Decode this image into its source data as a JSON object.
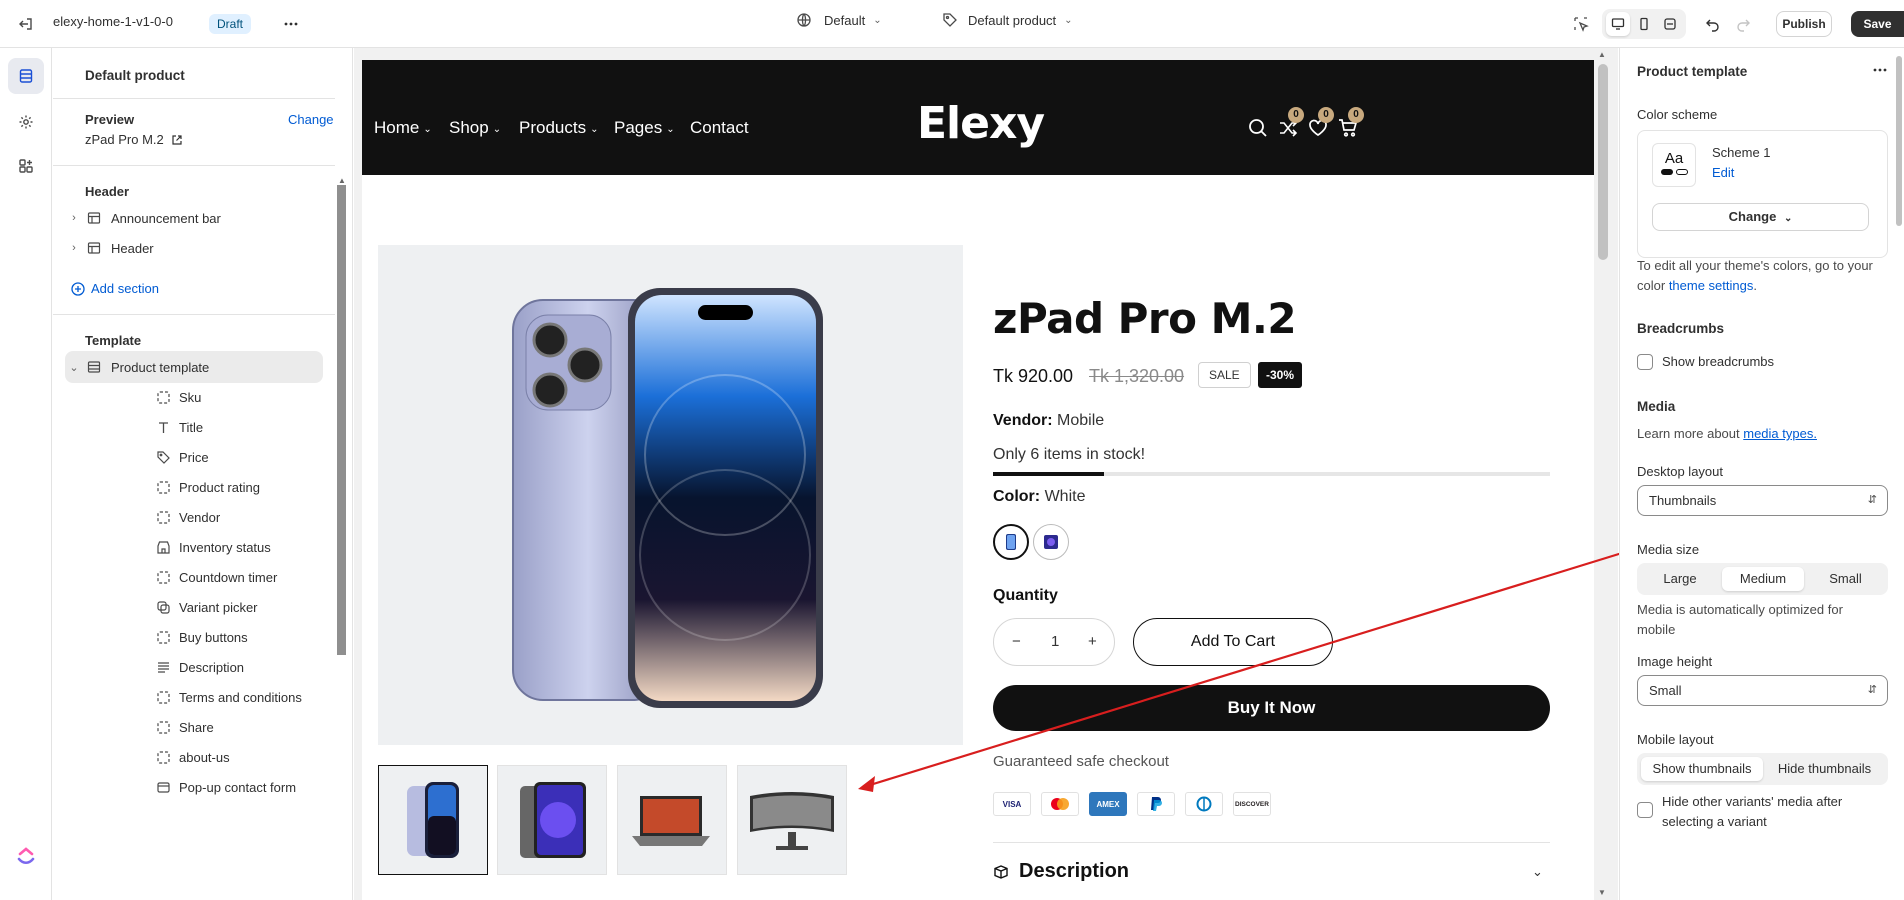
{
  "topbar": {
    "theme_name": "elexy-home-1-v1-0-0",
    "status_badge": "Draft",
    "context_select": "Default",
    "template_select": "Default product",
    "publish_label": "Publish",
    "save_label": "Save"
  },
  "sidebar": {
    "title": "Default product",
    "preview_label": "Preview",
    "preview_change": "Change",
    "preview_value": "zPad Pro M.2",
    "header_group": "Header",
    "header_items": [
      {
        "label": "Announcement bar"
      },
      {
        "label": "Header"
      }
    ],
    "add_section": "Add section",
    "template_group": "Template",
    "template_section": "Product template",
    "blocks": [
      {
        "label": "Sku",
        "icon": "dashed-square-icon"
      },
      {
        "label": "Title",
        "icon": "text-icon"
      },
      {
        "label": "Price",
        "icon": "price-tag-icon"
      },
      {
        "label": "Product rating",
        "icon": "dashed-square-icon"
      },
      {
        "label": "Vendor",
        "icon": "dashed-square-icon"
      },
      {
        "label": "Inventory status",
        "icon": "store-icon"
      },
      {
        "label": "Countdown timer",
        "icon": "dashed-square-icon"
      },
      {
        "label": "Variant picker",
        "icon": "variant-icon"
      },
      {
        "label": "Buy buttons",
        "icon": "dashed-square-icon"
      },
      {
        "label": "Description",
        "icon": "paragraph-icon"
      },
      {
        "label": "Terms and conditions",
        "icon": "dashed-square-icon"
      },
      {
        "label": "Share",
        "icon": "dashed-square-icon"
      },
      {
        "label": "about-us",
        "icon": "dashed-square-icon"
      },
      {
        "label": "Pop-up contact form",
        "icon": "popup-icon"
      }
    ]
  },
  "store": {
    "nav": [
      "Home",
      "Shop",
      "Products",
      "Pages",
      "Contact"
    ],
    "logo": "Elexy",
    "counts": [
      "0",
      "0",
      "0"
    ],
    "product": {
      "title": "zPad Pro M.2",
      "price": "Tk 920.00",
      "compare_price": "Tk 1,320.00",
      "sale_badge": "SALE",
      "discount_badge": "-30%",
      "vendor_label": "Vendor:",
      "vendor_value": "Mobile",
      "stock_text": "Only 6 items in stock!",
      "stock_fraction": 0.2,
      "color_label": "Color:",
      "color_value": "White",
      "quantity_label": "Quantity",
      "quantity_value": "1",
      "qty_minus": "−",
      "qty_plus": "+",
      "add_to_cart": "Add To Cart",
      "buy_now": "Buy It Now",
      "guarantee": "Guaranteed safe checkout",
      "payments": [
        "VISA",
        "MC",
        "AMEX",
        "PayPal",
        "Diners",
        "DISCOVER"
      ],
      "description_heading": "Description"
    }
  },
  "rpanel": {
    "title": "Product template",
    "color_scheme_label": "Color scheme",
    "scheme_sample": "Aa",
    "scheme_name": "Scheme 1",
    "scheme_edit": "Edit",
    "scheme_change": "Change",
    "scheme_note_prefix": "To edit all your theme's colors, go to your color",
    "scheme_note_link": "theme settings",
    "breadcrumbs_heading": "Breadcrumbs",
    "show_breadcrumbs": "Show breadcrumbs",
    "media_heading": "Media",
    "media_learn_prefix": "Learn more about",
    "media_learn_link": "media types.",
    "desktop_layout_label": "Desktop layout",
    "desktop_layout_value": "Thumbnails",
    "media_size_label": "Media size",
    "media_size_options": [
      "Large",
      "Medium",
      "Small"
    ],
    "media_size_note": "Media is automatically optimized for mobile",
    "image_height_label": "Image height",
    "image_height_value": "Small",
    "mobile_layout_label": "Mobile layout",
    "mobile_layout_options": [
      "Show thumbnails",
      "Hide thumbnails"
    ],
    "hide_variants_text": "Hide other variants' media after selecting a variant"
  }
}
